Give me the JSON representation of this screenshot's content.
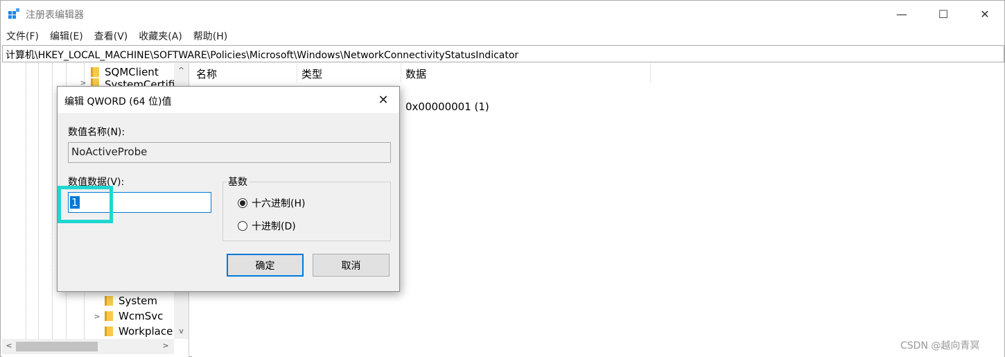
{
  "window": {
    "title": "注册表编辑器",
    "controls": {
      "minimize": "—",
      "maximize": "☐",
      "close": "✕"
    }
  },
  "menu": [
    "文件(F)",
    "编辑(E)",
    "查看(V)",
    "收藏夹(A)",
    "帮助(H)"
  ],
  "address": "计算机\\HKEY_LOCAL_MACHINE\\SOFTWARE\\Policies\\Microsoft\\Windows\\NetworkConnectivityStatusIndicator",
  "tree": {
    "items": [
      {
        "label": "SQMClient",
        "expandable": false
      },
      {
        "label": "SystemCertifi",
        "expandable": true
      },
      {
        "label": "System",
        "expandable": false
      },
      {
        "label": "WcmSvc",
        "expandable": true
      },
      {
        "label": "Workplace",
        "expandable": false
      }
    ]
  },
  "values": {
    "columns": [
      "名称",
      "类型",
      "数据"
    ],
    "rows": [
      {
        "data": "0x00000001 (1)"
      }
    ]
  },
  "dialog": {
    "title": "编辑 QWORD (64 位)值",
    "value_name_label": "数值名称(N):",
    "value_name": "NoActiveProbe",
    "value_data_label": "数值数据(V):",
    "value_data": "1",
    "base_label": "基数",
    "base_options": [
      {
        "label": "十六进制(H)",
        "checked": true
      },
      {
        "label": "十进制(D)",
        "checked": false
      }
    ],
    "ok_label": "确定",
    "cancel_label": "取消"
  },
  "watermark": "CSDN @越向青冥",
  "colors": {
    "accent": "#0078d7",
    "highlight": "#1fd6d0",
    "folder": "#f6c94d"
  }
}
